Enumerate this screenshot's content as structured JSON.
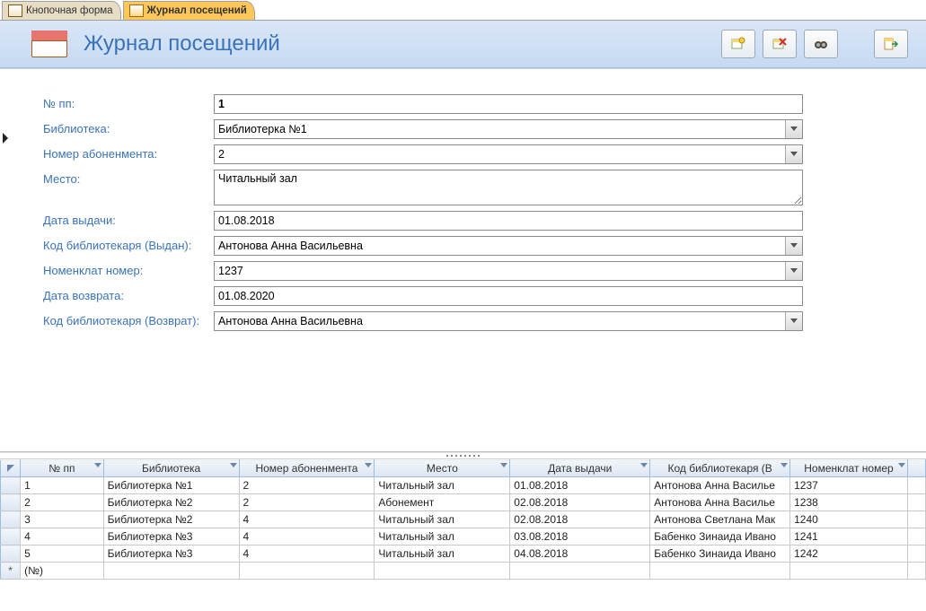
{
  "tabs": [
    {
      "label": "Кнопочная форма",
      "active": false
    },
    {
      "label": "Журнал посещений",
      "active": true
    }
  ],
  "form": {
    "title": "Журнал посещений",
    "fields": {
      "num_label": "№ пп:",
      "num_value": "1",
      "library_label": "Библиотека:",
      "library_value": "Библиотерка №1",
      "subscr_label": "Номер абоненмента:",
      "subscr_value": "2",
      "place_label": "Место:",
      "place_value": "Читальный зал",
      "issue_label": "Дата выдачи:",
      "issue_value": "01.08.2018",
      "libr_out_label": "Код библиотекаря (Выдан):",
      "libr_out_value": "Антонова Анна Васильевна",
      "nomen_label": "Номенклат номер:",
      "nomen_value": "1237",
      "return_label": "Дата возврата:",
      "return_value": "01.08.2020",
      "libr_in_label": "Код библиотекаря (Возврат):",
      "libr_in_value": "Антонова Анна Васильевна"
    }
  },
  "grid": {
    "columns": [
      "№ пп",
      "Библиотека",
      "Номер абоненмента",
      "Место",
      "Дата выдачи",
      "Код библиотекаря (В",
      "Номенклат номер"
    ],
    "rows": [
      [
        "1",
        "Библиотерка №1",
        "2",
        "Читальный зал",
        "01.08.2018",
        "Антонова Анна Василье",
        "1237"
      ],
      [
        "2",
        "Библиотерка №2",
        "2",
        "Абонемент",
        "02.08.2018",
        "Антонова Анна Василье",
        "1238"
      ],
      [
        "3",
        "Библиотерка №2",
        "4",
        "Читальный зал",
        "02.08.2018",
        "Антонова Светлана Мак",
        "1240"
      ],
      [
        "4",
        "Библиотерка №3",
        "4",
        "Читальный зал",
        "03.08.2018",
        "Бабенко Зинаида Ивано",
        "1241"
      ],
      [
        "5",
        "Библиотерка №3",
        "4",
        "Читальный зал",
        "04.08.2018",
        "Бабенко Зинаида Ивано",
        "1242"
      ]
    ],
    "new_row_placeholder": "(№)"
  }
}
